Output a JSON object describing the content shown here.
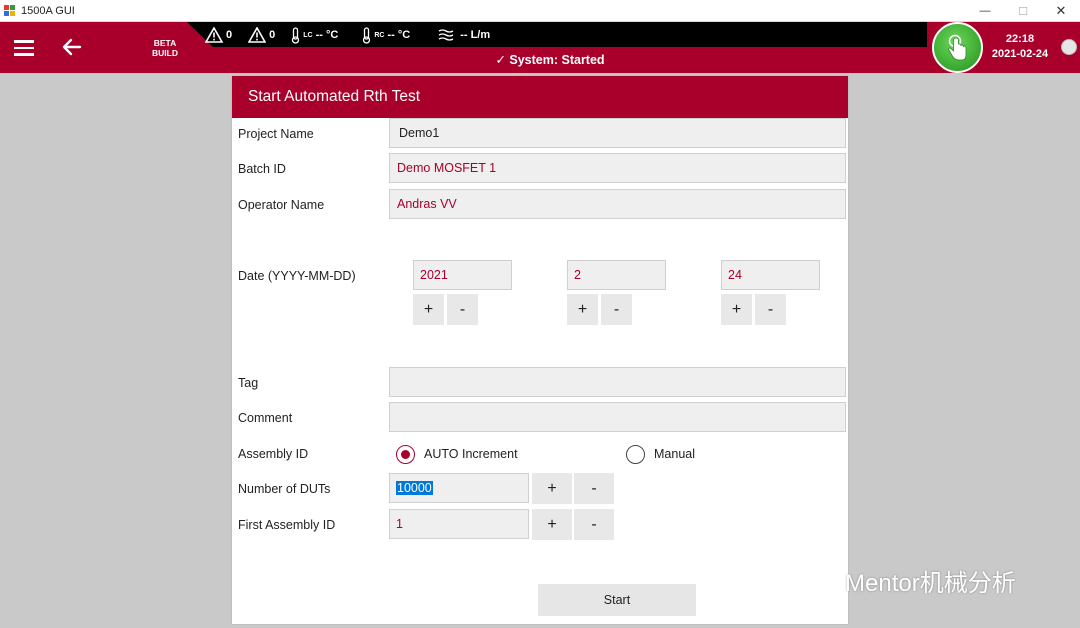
{
  "window": {
    "title": "1500A GUI",
    "min_glyph": "—",
    "max_glyph": "☐",
    "close_glyph": "✕"
  },
  "header": {
    "beta_line1": "BETA",
    "beta_line2": "BUILD",
    "warning_count_1": "0",
    "warning_count_2": "0",
    "lc_sub": "LC",
    "lc_value": "-- °C",
    "rc_sub": "RC",
    "rc_value": "-- °C",
    "flow_value": "-- L/m",
    "system_status": "✓ System: Started",
    "time": "22:18",
    "date": "2021-02-24"
  },
  "dialog": {
    "title": "Start Automated Rth Test",
    "project_name_label": "Project Name",
    "project_name_value": "Demo1",
    "batch_id_label": "Batch ID",
    "batch_id_value": "Demo MOSFET 1",
    "operator_label": "Operator Name",
    "operator_value": "Andras VV",
    "date_label": "Date (YYYY-MM-DD)",
    "year": "2021",
    "month": "2",
    "day": "24",
    "plus": "+",
    "minus": "-",
    "tag_label": "Tag",
    "tag_value": "",
    "comment_label": "Comment",
    "comment_value": "",
    "assembly_label": "Assembly ID",
    "auto_increment_label": "AUTO Increment",
    "manual_label": "Manual",
    "num_duts_label": "Number of DUTs",
    "num_duts_value": "10000",
    "first_assembly_label": "First Assembly ID",
    "first_assembly_value": "1",
    "start_label": "Start"
  },
  "watermark": {
    "text": "Mentor机械分析"
  },
  "colors": {
    "accent": "#a8002b",
    "header_band": "#000000",
    "touch_button": "#3fae34",
    "background": "#c9c9c9"
  },
  "icons": [
    "menu-icon",
    "back-arrow-icon",
    "warning-icon",
    "thermometer-icon",
    "flow-icon",
    "touch-hand-icon",
    "status-dot-icon",
    "close-icon",
    "minimize-icon",
    "maximize-icon",
    "wechat-icon"
  ]
}
